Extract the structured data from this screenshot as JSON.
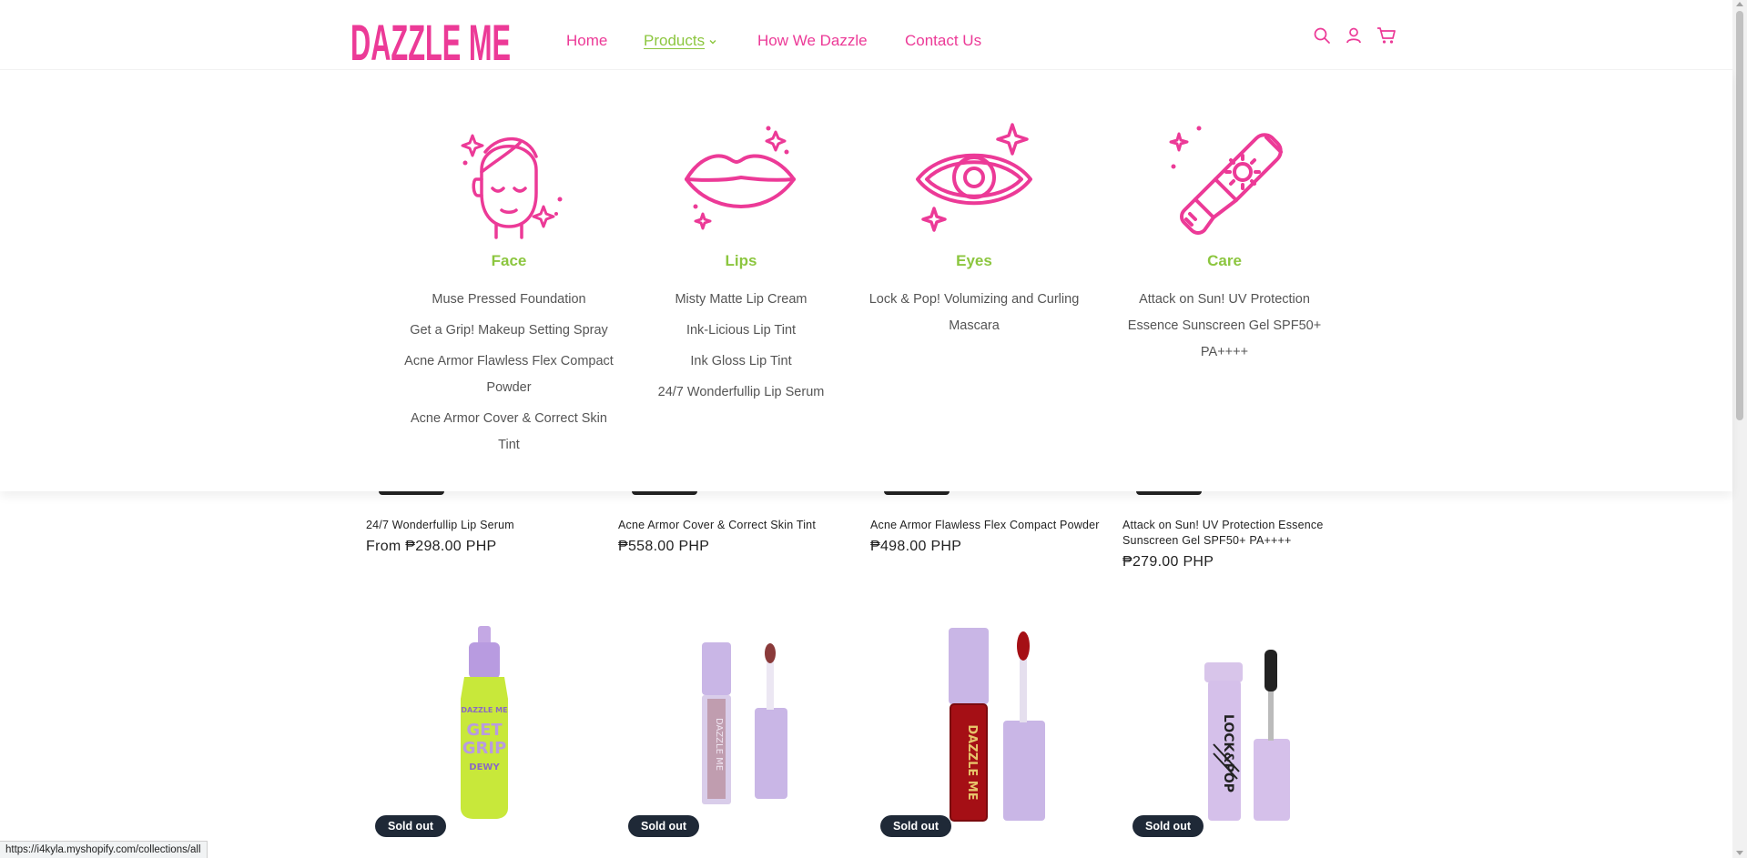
{
  "brand": {
    "logo_text": "DAZZLE ME",
    "pink": "#ec3a97",
    "green": "#8cc63f"
  },
  "nav": {
    "items": [
      {
        "label": "Home"
      },
      {
        "label": "Products"
      },
      {
        "label": "How We Dazzle"
      },
      {
        "label": "Contact Us"
      }
    ]
  },
  "header_icons": [
    "search-icon",
    "account-icon",
    "cart-icon"
  ],
  "mega_menu": {
    "columns": [
      {
        "title": "Face",
        "icon": "face-icon",
        "links": [
          "Muse Pressed Foundation",
          "Get a Grip! Makeup Setting Spray",
          "Acne Armor Flawless Flex Compact Powder",
          "Acne Armor Cover & Correct Skin Tint"
        ]
      },
      {
        "title": "Lips",
        "icon": "lips-icon",
        "links": [
          "Misty Matte Lip Cream",
          "Ink-Licious Lip Tint",
          "Ink Gloss Lip Tint",
          "24/7 Wonderfullip Lip Serum"
        ]
      },
      {
        "title": "Eyes",
        "icon": "eye-icon",
        "links": [
          "Lock & Pop! Volumizing and Curling Mascara"
        ]
      },
      {
        "title": "Care",
        "icon": "sunscreen-icon",
        "links": [
          "Attack on Sun! UV Protection Essence Sunscreen Gel SPF50+ PA++++"
        ]
      }
    ]
  },
  "products_row1": [
    {
      "name": "24/7 Wonderfullip Lip Serum",
      "price": "From ₱298.00 PHP"
    },
    {
      "name": "Acne Armor Cover & Correct Skin Tint",
      "price": "₱558.00 PHP"
    },
    {
      "name": "Acne Armor Flawless Flex Compact Powder",
      "price": "₱498.00 PHP"
    },
    {
      "name": "Attack on Sun! UV Protection Essence Sunscreen Gel SPF50+ PA++++",
      "price": "₱279.00 PHP"
    }
  ],
  "products_row2": [
    {
      "badge": "Sold out",
      "image": "setting-spray-bottle"
    },
    {
      "badge": "Sold out",
      "image": "lip-tint-mauve"
    },
    {
      "badge": "Sold out",
      "image": "lip-tint-red"
    },
    {
      "badge": "Sold out",
      "image": "mascara"
    }
  ],
  "status_bar": {
    "url": "https://i4kyla.myshopify.com/collections/all"
  }
}
